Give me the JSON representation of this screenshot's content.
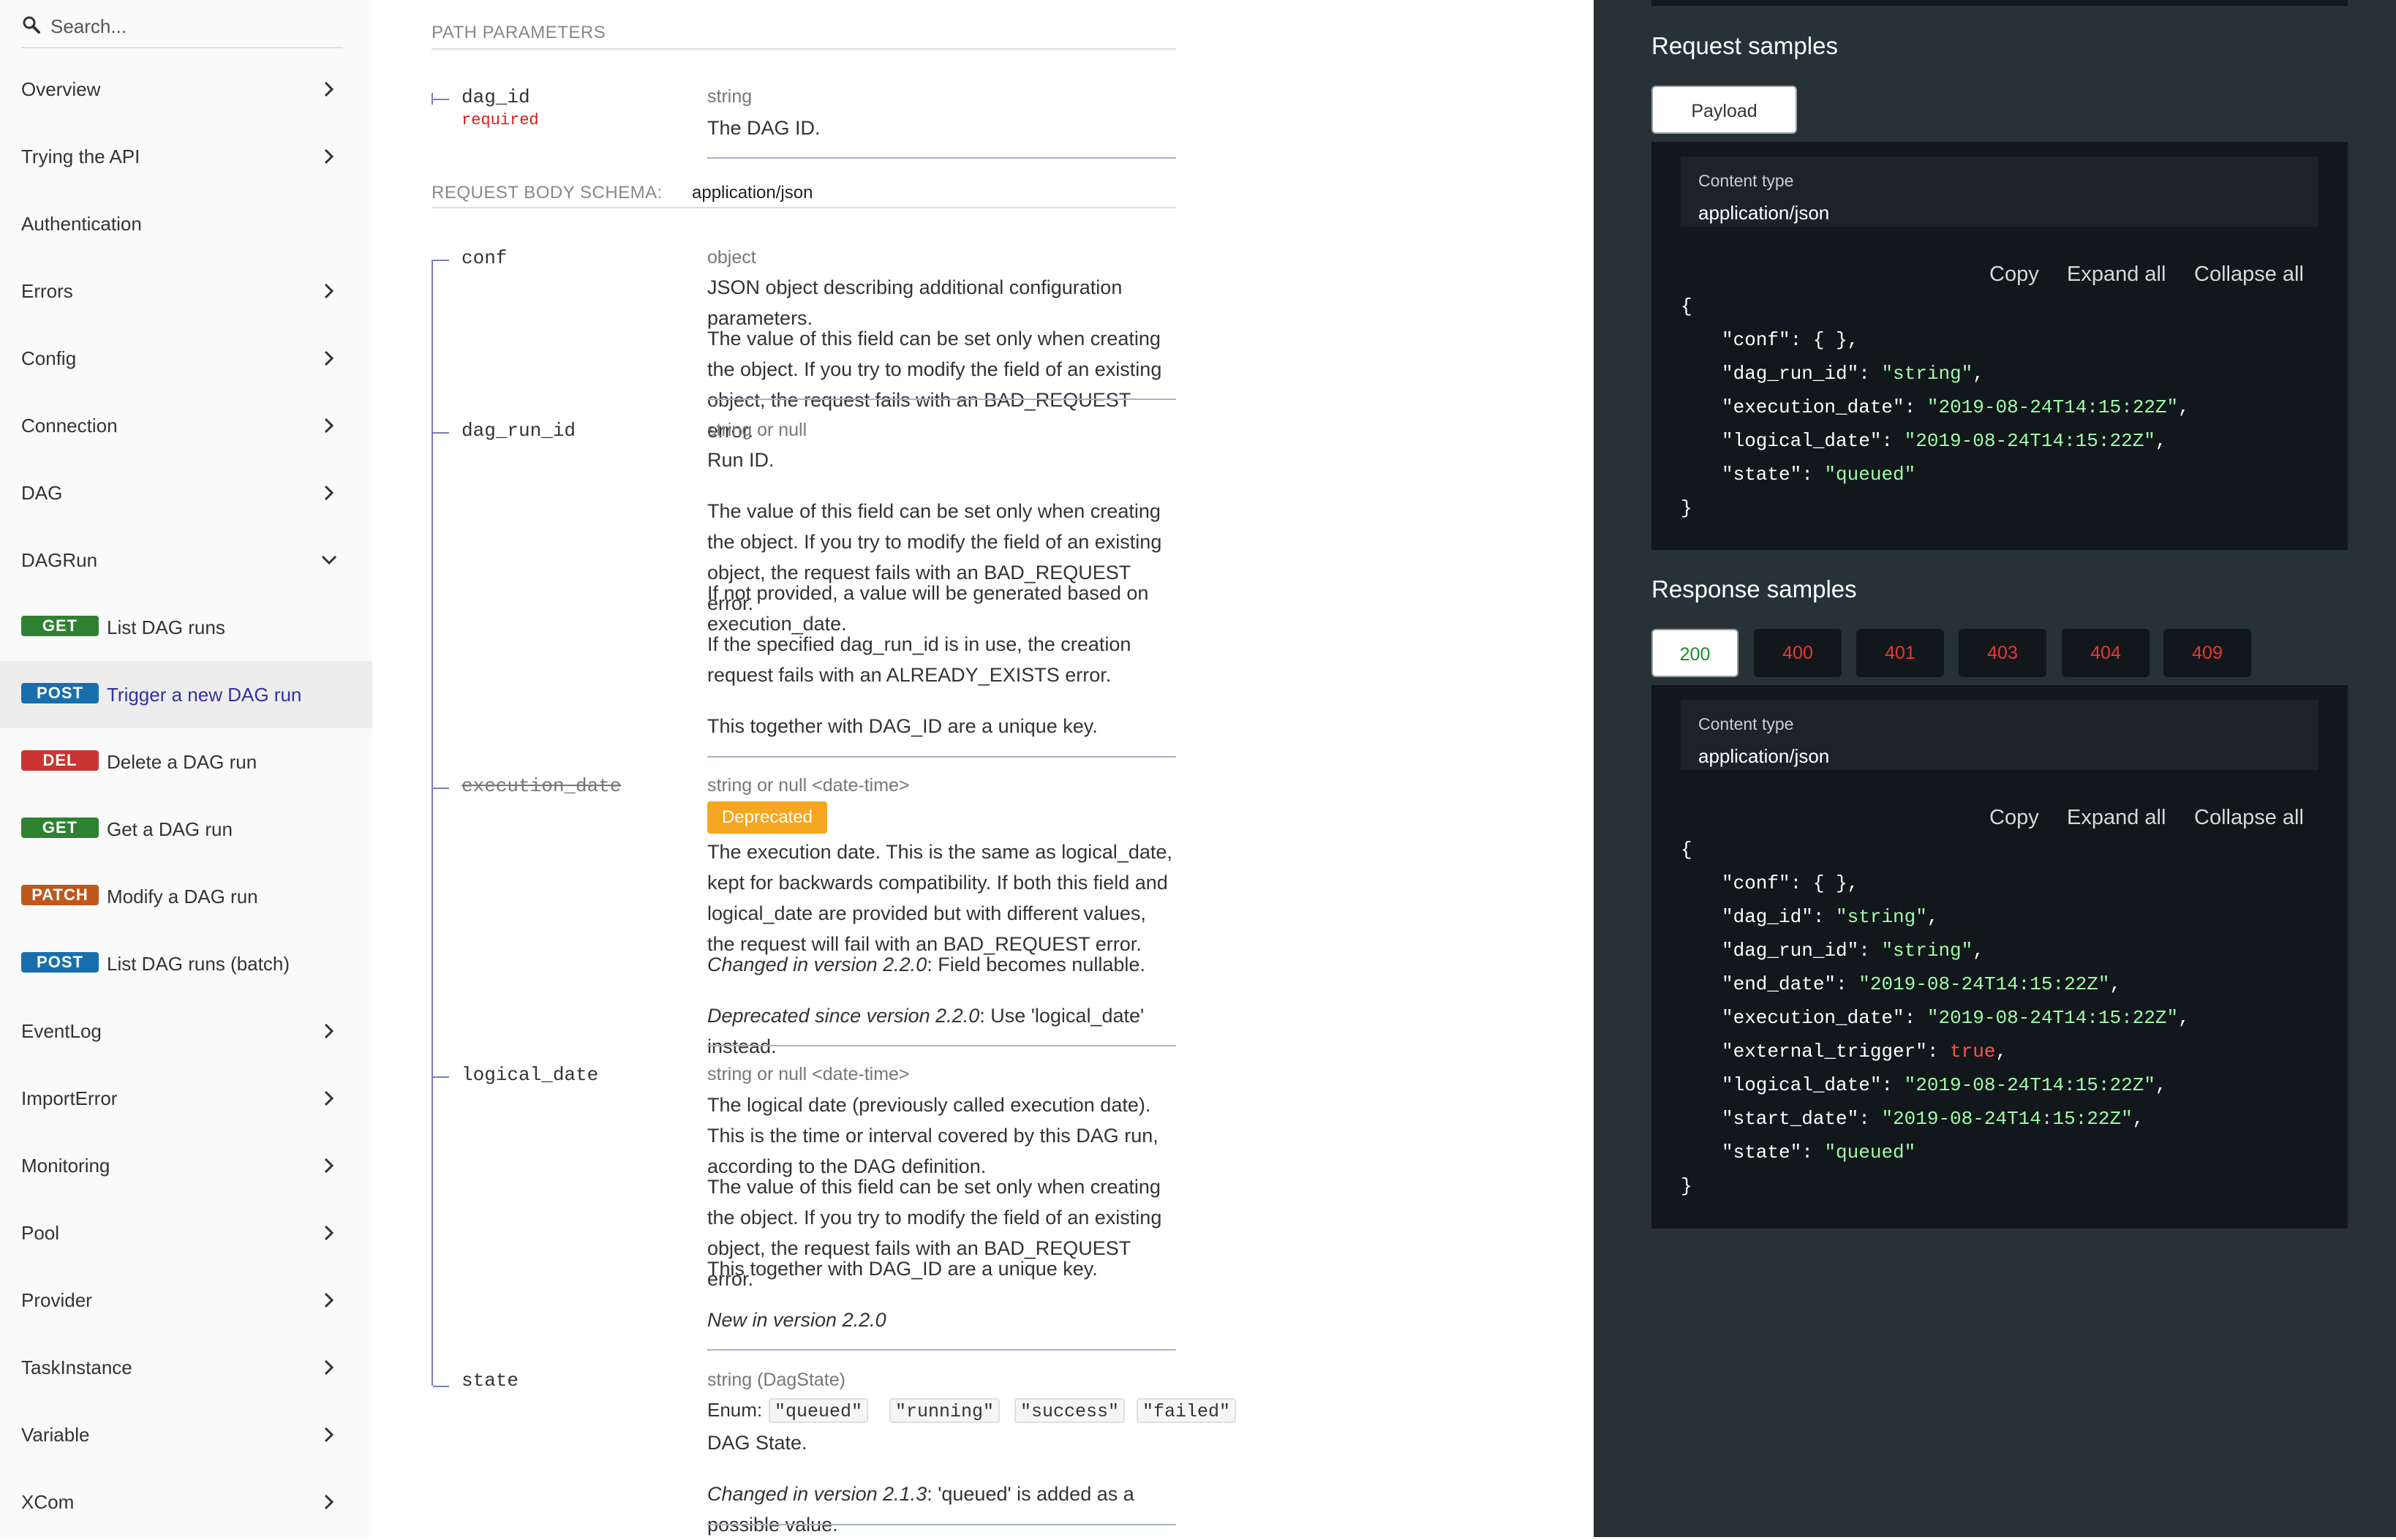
{
  "sidebar": {
    "search_placeholder": "Search...",
    "items_top": [
      {
        "label": "Overview"
      },
      {
        "label": "Trying the API"
      },
      {
        "label": "Authentication"
      },
      {
        "label": "Errors"
      },
      {
        "label": "Config"
      },
      {
        "label": "Connection"
      },
      {
        "label": "DAG"
      },
      {
        "label": "DAGRun"
      }
    ],
    "operations": [
      {
        "method": "GET",
        "label": "List DAG runs",
        "color": "#2f8132"
      },
      {
        "method": "POST",
        "label": "Trigger a new DAG run",
        "color": "#186fae"
      },
      {
        "method": "DEL",
        "label": "Delete a DAG run",
        "color": "#cc3333"
      },
      {
        "method": "GET",
        "label": "Get a DAG run",
        "color": "#2f8132"
      },
      {
        "method": "PATCH",
        "label": "Modify a DAG run",
        "color": "#bf581d"
      },
      {
        "method": "POST",
        "label": "List DAG runs (batch)",
        "color": "#186fae"
      }
    ],
    "items_bottom": [
      {
        "label": "EventLog"
      },
      {
        "label": "ImportError"
      },
      {
        "label": "Monitoring"
      },
      {
        "label": "Pool"
      },
      {
        "label": "Provider"
      },
      {
        "label": "TaskInstance"
      },
      {
        "label": "Variable"
      },
      {
        "label": "XCom"
      }
    ]
  },
  "main": {
    "path_params_title": "PATH PARAMETERS",
    "dag_id": {
      "name": "dag_id",
      "required": "required",
      "type": "string",
      "desc": "The DAG ID."
    },
    "body_schema_title": "REQUEST BODY SCHEMA:",
    "body_media": "application/json",
    "conf": {
      "name": "conf",
      "type": "object",
      "p1": "JSON object describing additional configuration parameters.",
      "p2": "The value of this field can be set only when creating the object. If you try to modify the field of an existing object, the request fails with an BAD_REQUEST error."
    },
    "dag_run_id": {
      "name": "dag_run_id",
      "type": "string or null",
      "p1": "Run ID.",
      "p2": "The value of this field can be set only when creating the object. If you try to modify the field of an existing object, the request fails with an BAD_REQUEST error.",
      "p3": "If not provided, a value will be generated based on execution_date.",
      "p4": "If the specified dag_run_id is in use, the creation request fails with an ALREADY_EXISTS error.",
      "p5": "This together with DAG_ID are a unique key."
    },
    "execution_date": {
      "name": "execution_date",
      "type": "string or null <date-time>",
      "badge": "Deprecated",
      "p1": "The execution date. This is the same as logical_date, kept for backwards compatibility. If both this field and logical_date are provided but with different values, the request will fail with an BAD_REQUEST error.",
      "p2_em": "Changed in version 2.2.0",
      "p2_rest": ": Field becomes nullable.",
      "p3_em": "Deprecated since version 2.2.0",
      "p3_rest": ": Use 'logical_date' instead."
    },
    "logical_date": {
      "name": "logical_date",
      "type": "string or null <date-time>",
      "p1": "The logical date (previously called execution date). This is the time or interval covered by this DAG run, according to the DAG definition.",
      "p2": "The value of this field can be set only when creating the object. If you try to modify the field of an existing object, the request fails with an BAD_REQUEST error.",
      "p3": "This together with DAG_ID are a unique key.",
      "p4": "New in version 2.2.0"
    },
    "state": {
      "name": "state",
      "type": "string (DagState)",
      "enum_label": "Enum:",
      "enum": [
        "\"queued\"",
        "\"running\"",
        "\"success\"",
        "\"failed\""
      ],
      "p1": "DAG State.",
      "p2_em": "Changed in version 2.1.3",
      "p2_rest": ": 'queued' is added as a possible value."
    }
  },
  "right": {
    "request_title": "Request samples",
    "request_tab": "Payload",
    "content_type_label": "Content type",
    "content_type_value": "application/json",
    "copy": "Copy",
    "expand": "Expand all",
    "collapse": "Collapse all",
    "request_code": [
      {
        "k": "{",
        "v": "",
        "t": ""
      },
      {
        "k": "\"conf\": ",
        "v": "{ },",
        "t": "p"
      },
      {
        "k": "\"dag_run_id\": ",
        "v": "\"string\"",
        "t": "s"
      },
      {
        "k": "\"execution_date\": ",
        "v": "\"2019-08-24T14:15:22Z\"",
        "t": "s"
      },
      {
        "k": "\"logical_date\": ",
        "v": "\"2019-08-24T14:15:22Z\"",
        "t": "s"
      },
      {
        "k": "\"state\": ",
        "v": "\"queued\"",
        "t": "s"
      },
      {
        "k": "}",
        "v": "",
        "t": ""
      }
    ],
    "response_title": "Response samples",
    "response_tabs": [
      "200",
      "400",
      "401",
      "403",
      "404",
      "409"
    ],
    "response_code": [
      {
        "k": "{",
        "v": "",
        "t": ""
      },
      {
        "k": "\"conf\": ",
        "v": "{ },",
        "t": "p"
      },
      {
        "k": "\"dag_id\": ",
        "v": "\"string\"",
        "t": "s"
      },
      {
        "k": "\"dag_run_id\": ",
        "v": "\"string\"",
        "t": "s"
      },
      {
        "k": "\"end_date\": ",
        "v": "\"2019-08-24T14:15:22Z\"",
        "t": "s"
      },
      {
        "k": "\"execution_date\": ",
        "v": "\"2019-08-24T14:15:22Z\"",
        "t": "s"
      },
      {
        "k": "\"external_trigger\": ",
        "v": "true",
        "t": "b"
      },
      {
        "k": "\"logical_date\": ",
        "v": "\"2019-08-24T14:15:22Z\"",
        "t": "s"
      },
      {
        "k": "\"start_date\": ",
        "v": "\"2019-08-24T14:15:22Z\"",
        "t": "s"
      },
      {
        "k": "\"state\": ",
        "v": "\"queued\"",
        "t": "s"
      },
      {
        "k": "}",
        "v": "",
        "t": ""
      }
    ]
  }
}
